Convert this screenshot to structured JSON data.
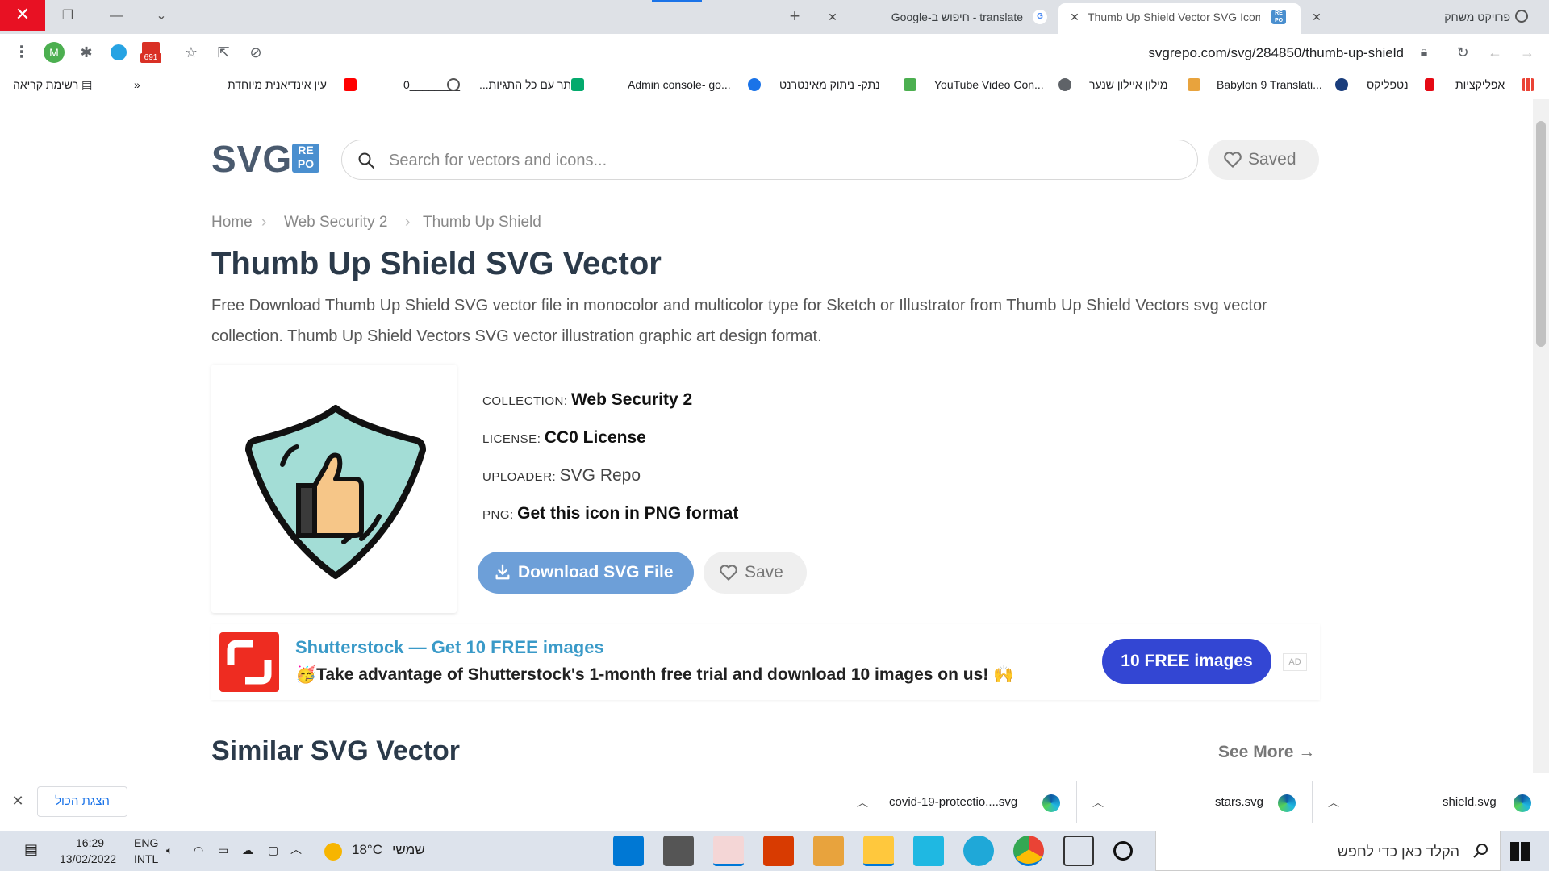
{
  "browser": {
    "tabs": [
      {
        "title": "פרויקט משחק"
      },
      {
        "title": "Thumb Up Shield Vector SVG Icon"
      },
      {
        "title": "translate - חיפוש ב-Google"
      }
    ],
    "url": "svgrepo.com/svg/284850/thumb-up-shield",
    "extension_badge": "691",
    "profile_initial": "M",
    "bookmarks": [
      {
        "label": "אפליקציות"
      },
      {
        "label": "נטפליקס"
      },
      {
        "label": "Babylon 9 Translati..."
      },
      {
        "label": "מילון איילון שנער"
      },
      {
        "label": "YouTube Video Con..."
      },
      {
        "label": "נתק- ניתוק מאינטרנט"
      },
      {
        "label": "Admin console- go..."
      },
      {
        "label": "אתר עם כל התגיות..."
      },
      {
        "label": "0________"
      },
      {
        "label": "עין אינדיאנית מיוחדת"
      },
      {
        "label": "»"
      },
      {
        "label": "רשימת קריאה"
      }
    ]
  },
  "site": {
    "logo_main": "SVG",
    "logo_badge": "REPO",
    "search_placeholder": "Search for vectors and icons...",
    "saved_label": "Saved"
  },
  "breadcrumb": [
    "Home",
    "Web Security 2",
    "Thumb Up Shield"
  ],
  "page": {
    "title": "Thumb Up Shield SVG Vector",
    "description": "Free Download Thumb Up Shield SVG vector file in monocolor and multicolor type for Sketch or Illustrator from Thumb Up Shield Vectors svg vector collection. Thumb Up Shield Vectors SVG vector illustration graphic art design format."
  },
  "meta": {
    "collection_key": "COLLECTION:",
    "collection_value": "Web Security 2",
    "license_key": "LICENSE:",
    "license_value": "CC0 License",
    "uploader_key": "UPLOADER:",
    "uploader_value": "SVG Repo",
    "png_key": "PNG:",
    "png_value": "Get this icon in PNG format"
  },
  "actions": {
    "download_label": "Download SVG File",
    "save_label": "Save"
  },
  "ad": {
    "title": "Shutterstock — Get 10 FREE images",
    "text": "🥳Take advantage of Shutterstock's 1-month free trial and download 10 images on us! 🙌",
    "button": "10 FREE images",
    "tag": "AD"
  },
  "similar": {
    "title": "Similar SVG Vector",
    "see_more": "See More"
  },
  "downloads": {
    "show_all": "הצגת הכול",
    "items": [
      {
        "name": "shield.svg"
      },
      {
        "name": "stars.svg"
      },
      {
        "name": "covid-19-protectio....svg"
      }
    ]
  },
  "taskbar": {
    "search_placeholder": "הקלד כאן כדי לחפש",
    "weather": "18°C",
    "weather_label": "שמשי",
    "lang_top": "ENG",
    "lang_bottom": "INTL",
    "time": "16:29",
    "date": "13/02/2022"
  },
  "colors": {
    "accent_blue": "#6d9fd8",
    "ad_blue": "#3346d3",
    "shield_fill": "#a3ddd6",
    "thumb_fill": "#f6c688",
    "close_red": "#e81123"
  }
}
